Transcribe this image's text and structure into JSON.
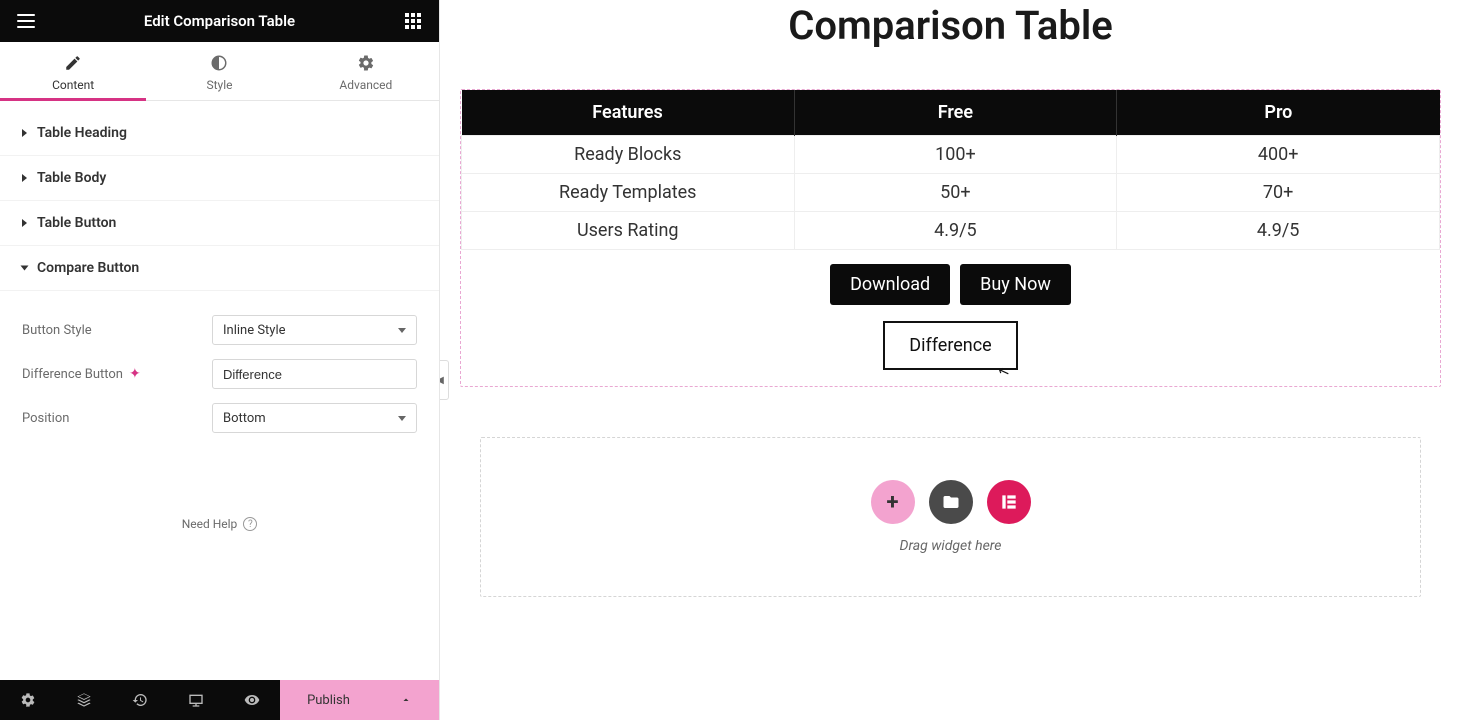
{
  "header": {
    "title": "Edit Comparison Table"
  },
  "tabs": {
    "content": "Content",
    "style": "Style",
    "advanced": "Advanced"
  },
  "sections": {
    "heading": "Table Heading",
    "body": "Table Body",
    "button": "Table Button",
    "compare": "Compare Button"
  },
  "controls": {
    "button_style_label": "Button Style",
    "button_style_value": "Inline Style",
    "diff_button_label": "Difference Button",
    "diff_button_value": "Difference",
    "position_label": "Position",
    "position_value": "Bottom"
  },
  "need_help": "Need Help",
  "publish": "Publish",
  "preview": {
    "title": "Comparison Table",
    "columns": [
      "Features",
      "Free",
      "Pro"
    ],
    "rows": [
      {
        "feature": "Ready Blocks",
        "free": "100+",
        "pro": "400+"
      },
      {
        "feature": "Ready Templates",
        "free": "50+",
        "pro": "70+"
      },
      {
        "feature": "Users Rating",
        "free": "4.9/5",
        "pro": "4.9/5"
      }
    ],
    "download": "Download",
    "buynow": "Buy Now",
    "difference": "Difference",
    "drag_text": "Drag widget here"
  }
}
